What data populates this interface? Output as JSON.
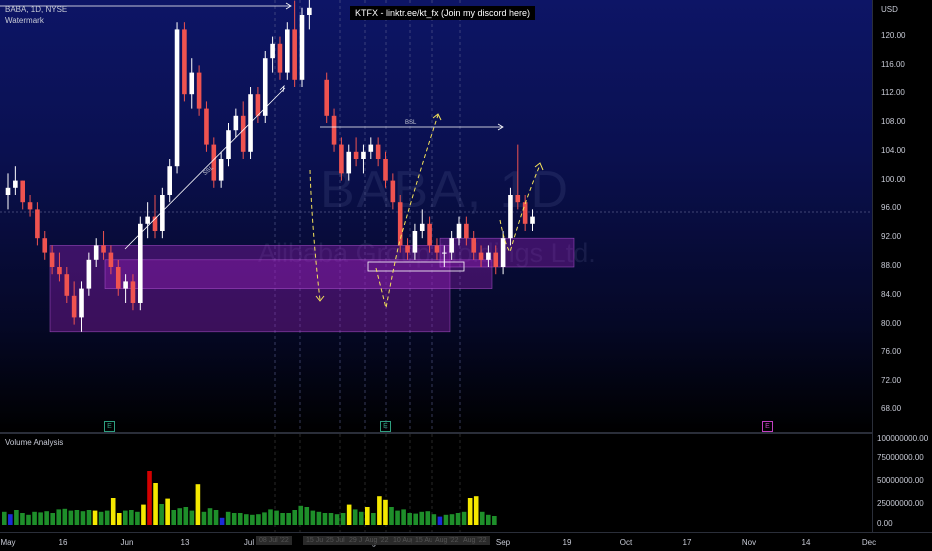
{
  "symbol_title": "BABA, 1D, NYSE",
  "watermark_label": "Watermark",
  "banner": "KTFX - linktr.ee/kt_fx (Join my discord here)",
  "watermark_big": "BABA, 1D",
  "watermark_name": "Alibaba Group Holdings Ltd.",
  "currency": "USD",
  "price_axis": [
    "120.00",
    "116.00",
    "112.00",
    "108.00",
    "104.00",
    "100.00",
    "96.00",
    "92.00",
    "88.00",
    "84.00",
    "80.00",
    "76.00",
    "72.00",
    "68.00"
  ],
  "volume_axis": [
    "100000000.00",
    "75000000.00",
    "50000000.00",
    "25000000.00",
    "0.00"
  ],
  "volume_title": "Volume Analysis",
  "annotations": {
    "ssl": "SSL",
    "bsl": "BSL"
  },
  "earnings_markers": [
    "E",
    "E",
    "E"
  ],
  "time_axis": [
    "May",
    "16",
    "Jun",
    "13",
    "Jul",
    "18",
    "Aug",
    "15",
    "Sep",
    "19",
    "Oct",
    "17",
    "Nov",
    "14",
    "Dec"
  ],
  "time_overlays": [
    "08 Jul '22",
    "15 Jul '22",
    "25 Jul '22",
    "29 Jul '22",
    "Aug '22",
    "10 Aug '22",
    "15 Aug '22",
    "Aug '22",
    "Aug '22"
  ],
  "colors": {
    "up": "#ffffff",
    "down": "#ef5350",
    "zone": "#a020c0",
    "wick": "#9ca3c4",
    "vol_green": "#1e8f2a",
    "vol_yellow": "#f5e800",
    "vol_red": "#d30000",
    "vol_blue": "#1b2bd8"
  },
  "chart_data": {
    "type": "candlestick",
    "ylim": [
      66,
      126
    ],
    "candles": [
      {
        "o": 98,
        "h": 101,
        "l": 96,
        "c": 99
      },
      {
        "o": 99,
        "h": 102,
        "l": 98,
        "c": 100
      },
      {
        "o": 100,
        "h": 100,
        "l": 96,
        "c": 97
      },
      {
        "o": 97,
        "h": 98,
        "l": 95,
        "c": 96
      },
      {
        "o": 96,
        "h": 97,
        "l": 91,
        "c": 92
      },
      {
        "o": 92,
        "h": 93,
        "l": 89,
        "c": 90
      },
      {
        "o": 90,
        "h": 91,
        "l": 87,
        "c": 88
      },
      {
        "o": 88,
        "h": 90,
        "l": 86,
        "c": 87
      },
      {
        "o": 87,
        "h": 88,
        "l": 83,
        "c": 84
      },
      {
        "o": 84,
        "h": 86,
        "l": 80,
        "c": 81
      },
      {
        "o": 81,
        "h": 86,
        "l": 79,
        "c": 85
      },
      {
        "o": 85,
        "h": 90,
        "l": 84,
        "c": 89
      },
      {
        "o": 89,
        "h": 92,
        "l": 88,
        "c": 91
      },
      {
        "o": 91,
        "h": 93,
        "l": 89,
        "c": 90
      },
      {
        "o": 90,
        "h": 91,
        "l": 87,
        "c": 88
      },
      {
        "o": 88,
        "h": 89,
        "l": 84,
        "c": 85
      },
      {
        "o": 85,
        "h": 87,
        "l": 83,
        "c": 86
      },
      {
        "o": 86,
        "h": 87,
        "l": 82,
        "c": 83
      },
      {
        "o": 83,
        "h": 95,
        "l": 82,
        "c": 94
      },
      {
        "o": 94,
        "h": 97,
        "l": 92,
        "c": 95
      },
      {
        "o": 95,
        "h": 98,
        "l": 92,
        "c": 93
      },
      {
        "o": 93,
        "h": 99,
        "l": 92,
        "c": 98
      },
      {
        "o": 98,
        "h": 103,
        "l": 97,
        "c": 102
      },
      {
        "o": 102,
        "h": 122,
        "l": 101,
        "c": 121
      },
      {
        "o": 121,
        "h": 122,
        "l": 111,
        "c": 112
      },
      {
        "o": 112,
        "h": 117,
        "l": 110,
        "c": 115
      },
      {
        "o": 115,
        "h": 116,
        "l": 109,
        "c": 110
      },
      {
        "o": 110,
        "h": 111,
        "l": 104,
        "c": 105
      },
      {
        "o": 105,
        "h": 106,
        "l": 99,
        "c": 100
      },
      {
        "o": 100,
        "h": 104,
        "l": 99,
        "c": 103
      },
      {
        "o": 103,
        "h": 108,
        "l": 102,
        "c": 107
      },
      {
        "o": 107,
        "h": 110,
        "l": 106,
        "c": 109
      },
      {
        "o": 109,
        "h": 111,
        "l": 103,
        "c": 104
      },
      {
        "o": 104,
        "h": 113,
        "l": 103,
        "c": 112
      },
      {
        "o": 112,
        "h": 113,
        "l": 108,
        "c": 109
      },
      {
        "o": 109,
        "h": 118,
        "l": 108,
        "c": 117
      },
      {
        "o": 117,
        "h": 120,
        "l": 115,
        "c": 119
      },
      {
        "o": 119,
        "h": 120,
        "l": 114,
        "c": 115
      },
      {
        "o": 115,
        "h": 122,
        "l": 114,
        "c": 121
      },
      {
        "o": 121,
        "h": 125,
        "l": 113,
        "c": 114
      },
      {
        "o": 114,
        "h": 124,
        "l": 113,
        "c": 123
      },
      {
        "o": 123,
        "h": 126,
        "l": 121,
        "c": 124
      },
      {
        "o": 114,
        "h": 115,
        "l": 108,
        "c": 109
      },
      {
        "o": 109,
        "h": 110,
        "l": 104,
        "c": 105
      },
      {
        "o": 105,
        "h": 106,
        "l": 100,
        "c": 101
      },
      {
        "o": 101,
        "h": 105,
        "l": 100,
        "c": 104
      },
      {
        "o": 104,
        "h": 106,
        "l": 102,
        "c": 103
      },
      {
        "o": 103,
        "h": 105,
        "l": 101,
        "c": 104
      },
      {
        "o": 104,
        "h": 106,
        "l": 103,
        "c": 105
      },
      {
        "o": 105,
        "h": 106,
        "l": 102,
        "c": 103
      },
      {
        "o": 103,
        "h": 104,
        "l": 99,
        "c": 100
      },
      {
        "o": 100,
        "h": 101,
        "l": 96,
        "c": 97
      },
      {
        "o": 97,
        "h": 98,
        "l": 90,
        "c": 91
      },
      {
        "o": 91,
        "h": 92,
        "l": 89,
        "c": 90
      },
      {
        "o": 90,
        "h": 94,
        "l": 89,
        "c": 93
      },
      {
        "o": 93,
        "h": 96,
        "l": 92,
        "c": 94
      },
      {
        "o": 94,
        "h": 95,
        "l": 90,
        "c": 91
      },
      {
        "o": 91,
        "h": 92,
        "l": 89,
        "c": 90
      },
      {
        "o": 90,
        "h": 91,
        "l": 88,
        "c": 90
      },
      {
        "o": 90,
        "h": 93,
        "l": 89,
        "c": 92
      },
      {
        "o": 92,
        "h": 95,
        "l": 91,
        "c": 94
      },
      {
        "o": 94,
        "h": 95,
        "l": 91,
        "c": 92
      },
      {
        "o": 92,
        "h": 93,
        "l": 89,
        "c": 90
      },
      {
        "o": 90,
        "h": 91,
        "l": 88,
        "c": 89
      },
      {
        "o": 89,
        "h": 91,
        "l": 88,
        "c": 90
      },
      {
        "o": 90,
        "h": 91,
        "l": 87,
        "c": 88
      },
      {
        "o": 88,
        "h": 93,
        "l": 87,
        "c": 92
      },
      {
        "o": 92,
        "h": 99,
        "l": 91,
        "c": 98
      },
      {
        "o": 98,
        "h": 105,
        "l": 96,
        "c": 97
      },
      {
        "o": 97,
        "h": 98,
        "l": 93,
        "c": 94
      },
      {
        "o": 94,
        "h": 96,
        "l": 93,
        "c": 95
      }
    ],
    "volume": [
      {
        "v": 22,
        "c": "g"
      },
      {
        "v": 18,
        "c": "b"
      },
      {
        "v": 25,
        "c": "g"
      },
      {
        "v": 20,
        "c": "g"
      },
      {
        "v": 17,
        "c": "g"
      },
      {
        "v": 22,
        "c": "g"
      },
      {
        "v": 21,
        "c": "g"
      },
      {
        "v": 23,
        "c": "g"
      },
      {
        "v": 20,
        "c": "g"
      },
      {
        "v": 26,
        "c": "g"
      },
      {
        "v": 27,
        "c": "g"
      },
      {
        "v": 24,
        "c": "g"
      },
      {
        "v": 25,
        "c": "g"
      },
      {
        "v": 23,
        "c": "g"
      },
      {
        "v": 25,
        "c": "g"
      },
      {
        "v": 24,
        "c": "y"
      },
      {
        "v": 22,
        "c": "g"
      },
      {
        "v": 24,
        "c": "g"
      },
      {
        "v": 45,
        "c": "y"
      },
      {
        "v": 20,
        "c": "y"
      },
      {
        "v": 24,
        "c": "g"
      },
      {
        "v": 25,
        "c": "g"
      },
      {
        "v": 22,
        "c": "g"
      },
      {
        "v": 34,
        "c": "y"
      },
      {
        "v": 90,
        "c": "r"
      },
      {
        "v": 70,
        "c": "y"
      },
      {
        "v": 35,
        "c": "g"
      },
      {
        "v": 44,
        "c": "y"
      },
      {
        "v": 25,
        "c": "g"
      },
      {
        "v": 28,
        "c": "g"
      },
      {
        "v": 30,
        "c": "g"
      },
      {
        "v": 24,
        "c": "g"
      },
      {
        "v": 68,
        "c": "y"
      },
      {
        "v": 22,
        "c": "g"
      },
      {
        "v": 28,
        "c": "g"
      },
      {
        "v": 25,
        "c": "g"
      },
      {
        "v": 12,
        "c": "b"
      },
      {
        "v": 22,
        "c": "g"
      },
      {
        "v": 20,
        "c": "g"
      },
      {
        "v": 20,
        "c": "g"
      },
      {
        "v": 18,
        "c": "g"
      },
      {
        "v": 17,
        "c": "g"
      },
      {
        "v": 18,
        "c": "g"
      },
      {
        "v": 21,
        "c": "g"
      },
      {
        "v": 26,
        "c": "g"
      },
      {
        "v": 24,
        "c": "g"
      },
      {
        "v": 20,
        "c": "g"
      },
      {
        "v": 20,
        "c": "g"
      },
      {
        "v": 25,
        "c": "g"
      },
      {
        "v": 32,
        "c": "g"
      },
      {
        "v": 30,
        "c": "g"
      },
      {
        "v": 24,
        "c": "g"
      },
      {
        "v": 22,
        "c": "g"
      },
      {
        "v": 20,
        "c": "g"
      },
      {
        "v": 20,
        "c": "g"
      },
      {
        "v": 18,
        "c": "g"
      },
      {
        "v": 20,
        "c": "g"
      },
      {
        "v": 34,
        "c": "y"
      },
      {
        "v": 26,
        "c": "g"
      },
      {
        "v": 22,
        "c": "g"
      },
      {
        "v": 30,
        "c": "y"
      },
      {
        "v": 20,
        "c": "g"
      },
      {
        "v": 48,
        "c": "y"
      },
      {
        "v": 42,
        "c": "y"
      },
      {
        "v": 30,
        "c": "g"
      },
      {
        "v": 24,
        "c": "g"
      },
      {
        "v": 26,
        "c": "g"
      },
      {
        "v": 20,
        "c": "g"
      },
      {
        "v": 19,
        "c": "g"
      },
      {
        "v": 22,
        "c": "g"
      },
      {
        "v": 23,
        "c": "g"
      },
      {
        "v": 18,
        "c": "g"
      },
      {
        "v": 14,
        "c": "b"
      },
      {
        "v": 17,
        "c": "g"
      },
      {
        "v": 18,
        "c": "g"
      },
      {
        "v": 20,
        "c": "g"
      },
      {
        "v": 22,
        "c": "g"
      },
      {
        "v": 45,
        "c": "y"
      },
      {
        "v": 48,
        "c": "y"
      },
      {
        "v": 22,
        "c": "g"
      },
      {
        "v": 17,
        "c": "g"
      },
      {
        "v": 15,
        "c": "g"
      }
    ],
    "zones": [
      {
        "p1": 91,
        "p2": 79
      },
      {
        "p1": 89,
        "p2": 85
      },
      {
        "p1": 92,
        "p2": 88
      }
    ]
  }
}
